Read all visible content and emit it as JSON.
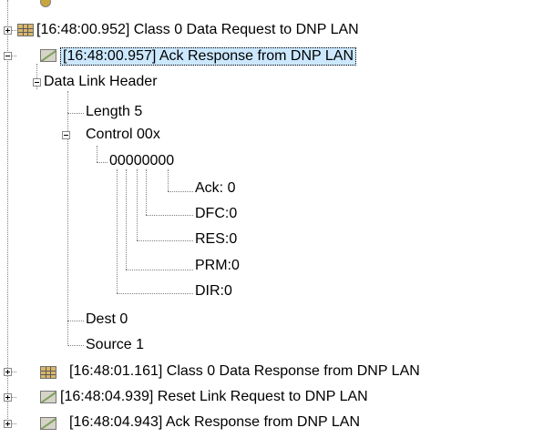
{
  "tree": {
    "items": [
      {
        "label": "[16:48:00.952] Class 0 Data Request to DNP LAN",
        "icon": "data-grid-icon"
      },
      {
        "label": "[16:48:00.957] Ack Response from DNP LAN",
        "icon": "ack-packet-icon",
        "selected": true
      },
      {
        "label": "Data Link Header"
      },
      {
        "label": "Length 5"
      },
      {
        "label": "Control 00x"
      },
      {
        "label": "00000000"
      },
      {
        "label": "Ack: 0"
      },
      {
        "label": "DFC:0"
      },
      {
        "label": "RES:0"
      },
      {
        "label": "PRM:0"
      },
      {
        "label": "DIR:0"
      },
      {
        "label": "Dest 0"
      },
      {
        "label": "Source 1"
      },
      {
        "label": "[16:48:01.161] Class 0 Data Response from DNP LAN",
        "icon": "data-grid-icon"
      },
      {
        "label": "[16:48:04.939] Reset Link Request to DNP LAN",
        "icon": "ack-packet-icon"
      },
      {
        "label": "[16:48:04.943] Ack Response from DNP LAN",
        "icon": "ack-packet-icon"
      }
    ]
  },
  "colors": {
    "selection": "#cce8ff",
    "tree_lines": "#808080"
  }
}
